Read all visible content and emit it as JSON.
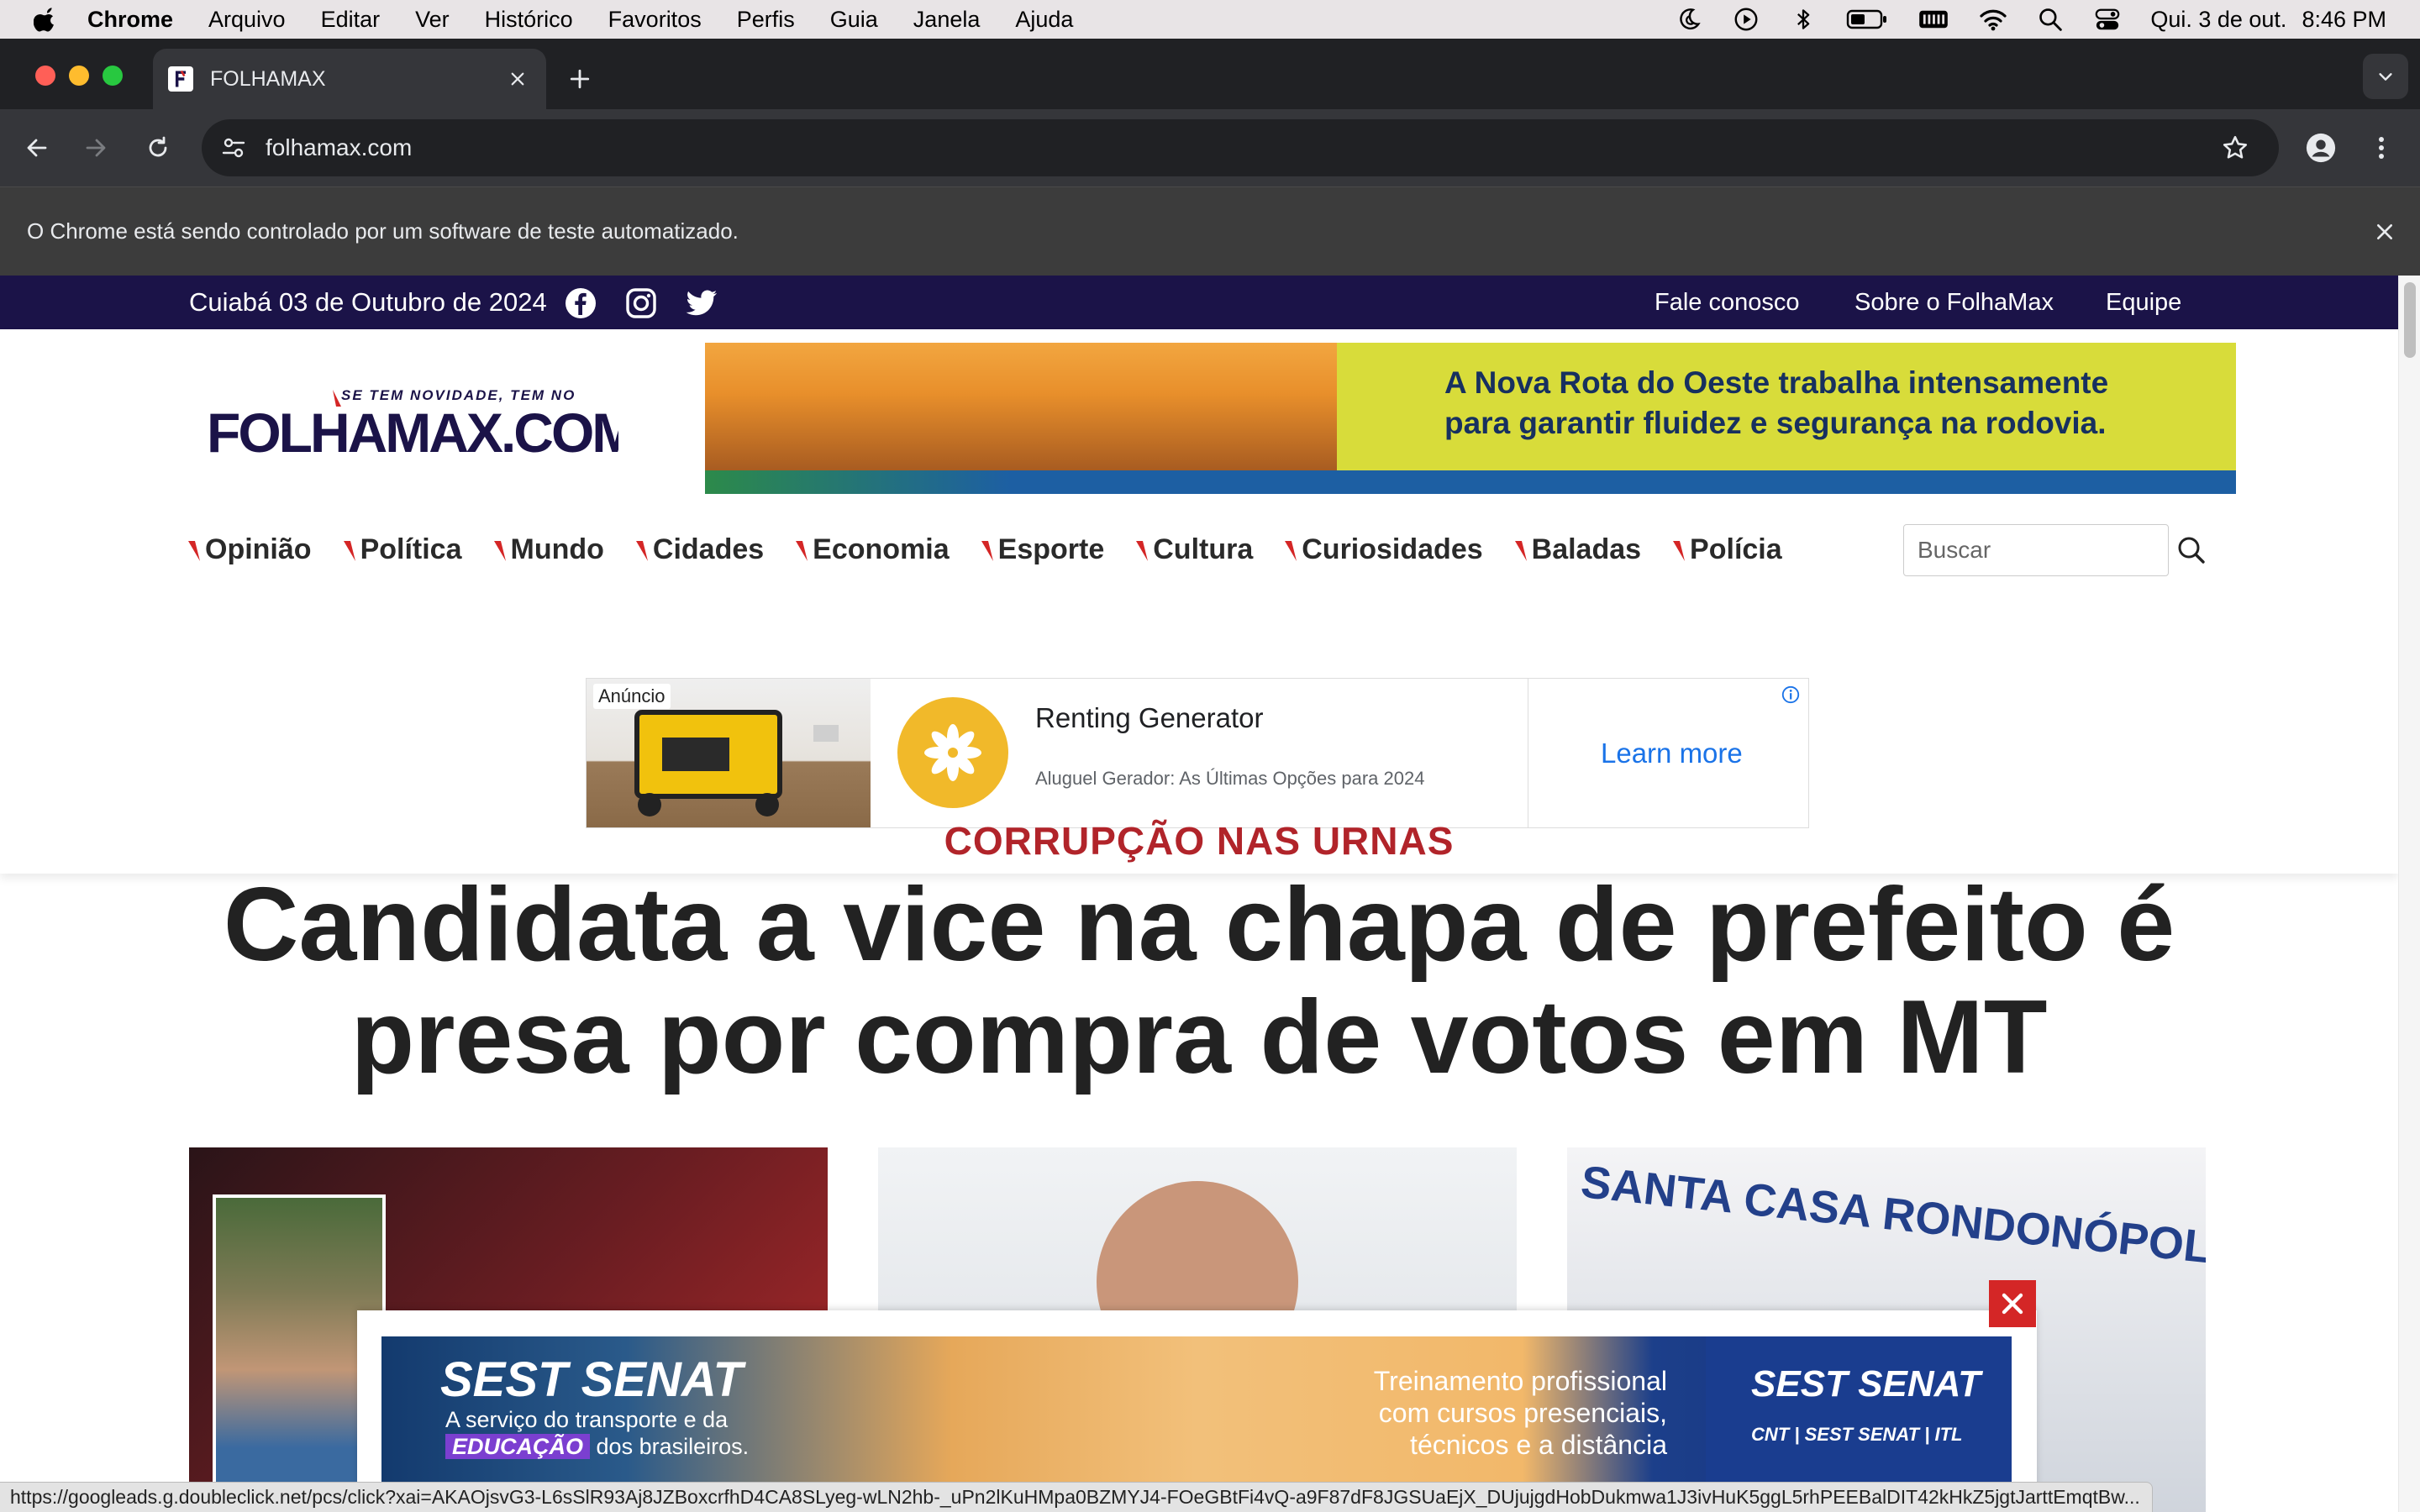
{
  "menubar": {
    "app_name": "Chrome",
    "items": [
      "Arquivo",
      "Editar",
      "Ver",
      "Histórico",
      "Favoritos",
      "Perfis",
      "Guia",
      "Janela",
      "Ajuda"
    ],
    "date": "Qui. 3 de out.",
    "time": "8:46 PM"
  },
  "browser": {
    "tab_title": "FOLHAMAX",
    "url": "folhamax.com",
    "infobar_text": "O Chrome está sendo controlado por um software de teste automatizado."
  },
  "site": {
    "topbar": {
      "date": "Cuiabá 03 de Outubro de 2024",
      "links": [
        "Fale conosco",
        "Sobre o FolhaMax",
        "Equipe"
      ]
    },
    "logo": {
      "tagline": "SE TEM NOVIDADE, TEM NO",
      "name": "FOLHAMAX.COM"
    },
    "header_banner": {
      "text_line1": "A Nova Rota do Oeste trabalha intensamente",
      "text_line2": "para garantir fluidez e segurança na rodovia."
    },
    "nav": [
      "Opinião",
      "Política",
      "Mundo",
      "Cidades",
      "Economia",
      "Esporte",
      "Cultura",
      "Curiosidades",
      "Baladas",
      "Polícia"
    ],
    "search": {
      "placeholder": "Buscar"
    },
    "ad": {
      "label": "Anúncio",
      "title": "Renting Generator",
      "description": "Aluguel Gerador: As Últimas Opções para 2024",
      "cta": "Learn more"
    },
    "lead": {
      "kicker": "CORRUPÇÃO NAS URNAS",
      "headline": "Candidata a vice na chapa de prefeito é presa por compra de votos em MT"
    },
    "cards": [
      {
        "caption": ""
      },
      {
        "caption": ""
      },
      {
        "sign_text": "SANTA CASA RONDONÓPOLIS - DES"
      }
    ],
    "sticky_ad": {
      "brand": "SEST SENAT",
      "tagline_1": "A serviço do transporte e da",
      "tagline_2_highlight": "EDUCAÇÃO",
      "tagline_2_rest": "dos brasileiros.",
      "training_1": "Treinamento profissional",
      "training_2": "com cursos presenciais,",
      "training_3": "técnicos e a distância",
      "brand_right": "SEST SENAT",
      "sub_brand": "CNT | SEST SENAT | ITL"
    }
  },
  "statusbar": {
    "url": "https://googleads.g.doubleclick.net/pcs/click?xai=AKAOjsvG3-L6sSlR93Aj8JZBoxcrfhD4CA8SLyeg-wLN2hb-_uPn2lKuHMpa0BZMYJ4-FOeGBtFi4vQ-a9F87dF8JGSUaEjX_DUjujgdHobDukmwa1J3ivHuK5ggL5rhPEEBalDIT42kHkZ5jgtJarttEmqtBw..."
  },
  "colors": {
    "topbar_bg": "#1b1348",
    "kicker_red": "#b1242a",
    "link_blue": "#1a73e8",
    "chrome_dark": "#202124"
  }
}
